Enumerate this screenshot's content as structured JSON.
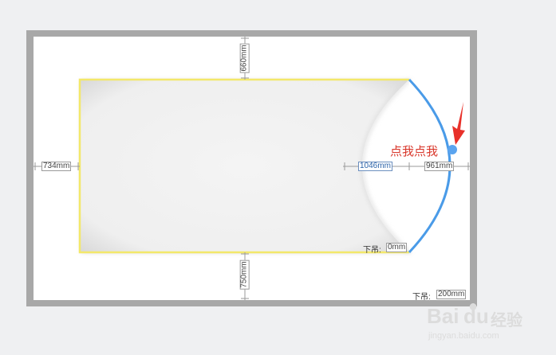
{
  "dimensions": {
    "top": "660mm",
    "left": "734mm",
    "bottom": "750mm",
    "inner": "1046mm",
    "right": "961mm"
  },
  "drops": {
    "inner_label": "下吊:",
    "inner_value": "0mm",
    "outer_label": "下吊:",
    "outer_value": "200mm"
  },
  "annotation": {
    "text": "点我点我"
  },
  "watermark": {
    "brand": "Bai",
    "brand2": "du",
    "suffix": "经验",
    "url": "jingyan.baidu.com"
  },
  "colors": {
    "outer_frame": "#a8a8a8",
    "room_outline": "#f3e86a",
    "arc": "#4a9be8",
    "handle": "#5aa4ef",
    "arrow": "#e8312a",
    "annotation_text": "#d9372b"
  },
  "icons": {
    "arrow": "red-arrow-icon",
    "handle": "drag-handle-icon"
  }
}
